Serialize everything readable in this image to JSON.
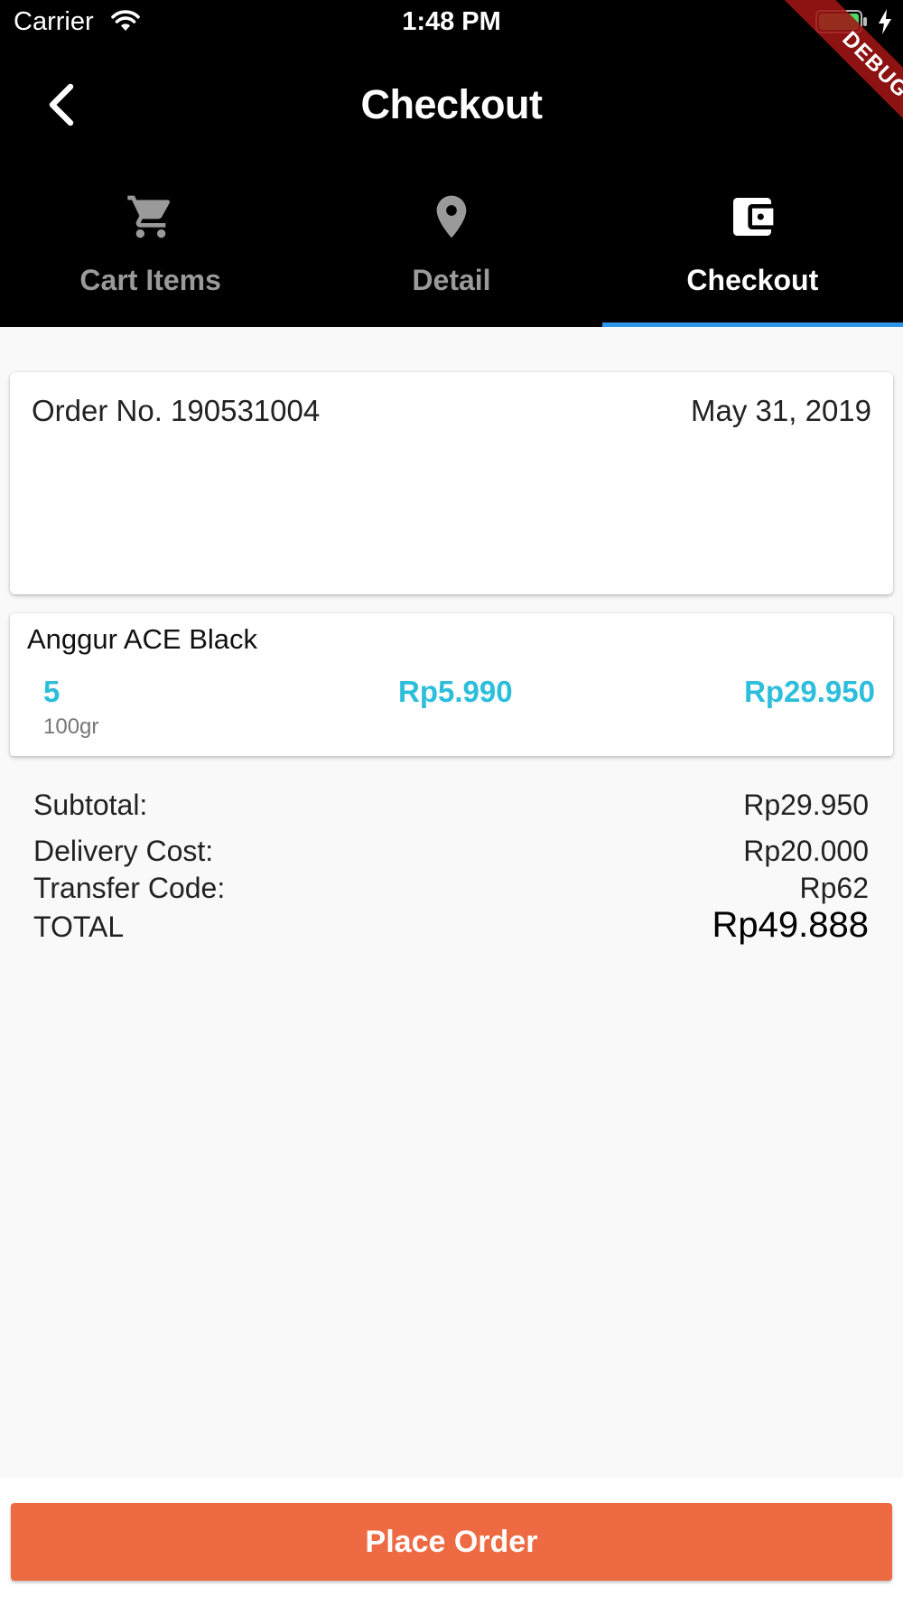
{
  "status_bar": {
    "carrier": "Carrier",
    "time": "1:48 PM",
    "battery_color": "#4cd964"
  },
  "app_bar": {
    "title": "Checkout",
    "back_icon": "chevron-left-icon"
  },
  "tabs": [
    {
      "label": "Cart Items",
      "icon": "cart-icon",
      "active": false
    },
    {
      "label": "Detail",
      "icon": "location-pin-icon",
      "active": false
    },
    {
      "label": "Checkout",
      "icon": "wallet-icon",
      "active": true
    }
  ],
  "tab_indicator_color": "#2f95e6",
  "order": {
    "number_label": "Order No. 190531004",
    "date": "May 31, 2019"
  },
  "items": [
    {
      "name": "Anggur ACE Black",
      "quantity": "5",
      "unit": "100gr",
      "price": "Rp5.990",
      "total": "Rp29.950"
    }
  ],
  "accent_color": "#2cbedb",
  "summary": {
    "subtotal_label": "Subtotal:",
    "subtotal_value": "Rp29.950",
    "delivery_label": "Delivery Cost:",
    "delivery_value": "Rp20.000",
    "transfer_label": "Transfer Code:",
    "transfer_value": "Rp62",
    "total_label": "TOTAL",
    "total_value": "Rp49.888"
  },
  "place_order": {
    "label": "Place Order",
    "color": "#ee6a43"
  },
  "debug_banner": "DEBUG"
}
